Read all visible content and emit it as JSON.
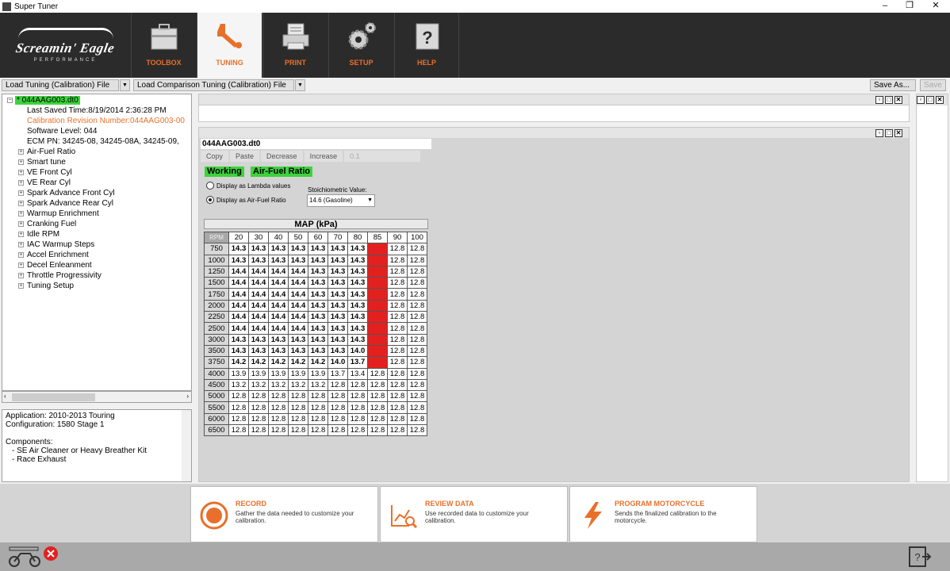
{
  "window": {
    "title": "Super Tuner",
    "min": "–",
    "max": "❐",
    "close": "✕"
  },
  "brand": {
    "logo_text": "Screamin' Eagle",
    "logo_sub": "PERFORMANCE"
  },
  "nav": {
    "tabs": [
      {
        "label": "TOOLBOX",
        "icon": "toolbox-icon"
      },
      {
        "label": "TUNING",
        "icon": "wrench-icon",
        "active": true
      },
      {
        "label": "PRINT",
        "icon": "printer-icon"
      },
      {
        "label": "SETUP",
        "icon": "gears-icon"
      },
      {
        "label": "HELP",
        "icon": "help-icon"
      }
    ]
  },
  "toolbar": {
    "load_tuning": "Load Tuning (Calibration) File",
    "load_comparison": "Load Comparison Tuning (Calibration) File",
    "save_as": "Save As...",
    "save": "Save"
  },
  "tree": {
    "root": "* 044AAG003.dt0",
    "meta": [
      "Last Saved Time:8/19/2014 2:36:28 PM",
      "Calibration Revision Number:044AAG003-00",
      "Software Level: 044",
      "ECM PN: 34245-08, 34245-08A, 34245-09,"
    ],
    "items": [
      "Air-Fuel Ratio",
      "Smart tune",
      "VE Front Cyl",
      "VE Rear Cyl",
      "Spark Advance Front Cyl",
      "Spark Advance Rear Cyl",
      "Warmup Enrichment",
      "Cranking Fuel",
      "Idle RPM",
      "IAC Warmup Steps",
      "Accel Enrichment",
      "Decel Enleanment",
      "Throttle Progressivity",
      "Tuning Setup"
    ]
  },
  "info": {
    "application": "Application: 2010-2013 Touring",
    "configuration": "Configuration: 1580 Stage 1",
    "components_label": "Components:",
    "components": [
      "- SE Air Cleaner or Heavy Breather Kit",
      "- Race Exhaust"
    ]
  },
  "editor": {
    "doc_name": "044AAG003.dt0",
    "copy": "Copy",
    "paste": "Paste",
    "decrease": "Decrease",
    "increase": "Increase",
    "step": "0.1",
    "badge_working": "Working",
    "badge_table": "Air-Fuel Ratio",
    "radio_lambda": "Display as Lambda values",
    "radio_afr": "Display as Air-Fuel Ratio",
    "stoich_label": "Stoichiometric Value:",
    "stoich_value": "14.6 (Gasoline)"
  },
  "table": {
    "title": "MAP (kPa)",
    "corner": "RPM",
    "columns": [
      "20",
      "30",
      "40",
      "50",
      "60",
      "70",
      "80",
      "85",
      "90",
      "100"
    ],
    "rows": [
      {
        "rpm": "750",
        "values": [
          "14.3",
          "14.3",
          "14.3",
          "14.3",
          "14.3",
          "14.3",
          "14.3",
          "14.1",
          "12.8",
          "12.8"
        ]
      },
      {
        "rpm": "1000",
        "values": [
          "14.3",
          "14.3",
          "14.3",
          "14.3",
          "14.3",
          "14.3",
          "14.3",
          "14.1",
          "12.8",
          "12.8"
        ]
      },
      {
        "rpm": "1250",
        "values": [
          "14.4",
          "14.4",
          "14.4",
          "14.4",
          "14.3",
          "14.3",
          "14.3",
          "14.1",
          "12.8",
          "12.8"
        ]
      },
      {
        "rpm": "1500",
        "values": [
          "14.4",
          "14.4",
          "14.4",
          "14.4",
          "14.3",
          "14.3",
          "14.3",
          "14.1",
          "12.8",
          "12.8"
        ]
      },
      {
        "rpm": "1750",
        "values": [
          "14.4",
          "14.4",
          "14.4",
          "14.4",
          "14.3",
          "14.3",
          "14.3",
          "14.1",
          "12.8",
          "12.8"
        ]
      },
      {
        "rpm": "2000",
        "values": [
          "14.4",
          "14.4",
          "14.4",
          "14.4",
          "14.3",
          "14.3",
          "14.3",
          "14.1",
          "12.8",
          "12.8"
        ]
      },
      {
        "rpm": "2250",
        "values": [
          "14.4",
          "14.4",
          "14.4",
          "14.4",
          "14.3",
          "14.3",
          "14.3",
          "14.1",
          "12.8",
          "12.8"
        ]
      },
      {
        "rpm": "2500",
        "values": [
          "14.4",
          "14.4",
          "14.4",
          "14.4",
          "14.3",
          "14.3",
          "14.3",
          "13.8",
          "12.8",
          "12.8"
        ]
      },
      {
        "rpm": "3000",
        "values": [
          "14.3",
          "14.3",
          "14.3",
          "14.3",
          "14.3",
          "14.3",
          "14.3",
          "13.8",
          "12.8",
          "12.8"
        ]
      },
      {
        "rpm": "3500",
        "values": [
          "14.3",
          "14.3",
          "14.3",
          "14.3",
          "14.3",
          "14.3",
          "14.0",
          "13.5",
          "12.8",
          "12.8"
        ]
      },
      {
        "rpm": "3750",
        "values": [
          "14.2",
          "14.2",
          "14.2",
          "14.2",
          "14.2",
          "14.0",
          "13.7",
          "13.0",
          "12.8",
          "12.8"
        ]
      },
      {
        "rpm": "4000",
        "values": [
          "13.9",
          "13.9",
          "13.9",
          "13.9",
          "13.9",
          "13.7",
          "13.4",
          "12.8",
          "12.8",
          "12.8"
        ]
      },
      {
        "rpm": "4500",
        "values": [
          "13.2",
          "13.2",
          "13.2",
          "13.2",
          "13.2",
          "12.8",
          "12.8",
          "12.8",
          "12.8",
          "12.8"
        ]
      },
      {
        "rpm": "5000",
        "values": [
          "12.8",
          "12.8",
          "12.8",
          "12.8",
          "12.8",
          "12.8",
          "12.8",
          "12.8",
          "12.8",
          "12.8"
        ]
      },
      {
        "rpm": "5500",
        "values": [
          "12.8",
          "12.8",
          "12.8",
          "12.8",
          "12.8",
          "12.8",
          "12.8",
          "12.8",
          "12.8",
          "12.8"
        ]
      },
      {
        "rpm": "6000",
        "values": [
          "12.8",
          "12.8",
          "12.8",
          "12.8",
          "12.8",
          "12.8",
          "12.8",
          "12.8",
          "12.8",
          "12.8"
        ]
      },
      {
        "rpm": "6500",
        "values": [
          "12.8",
          "12.8",
          "12.8",
          "12.8",
          "12.8",
          "12.8",
          "12.8",
          "12.8",
          "12.8",
          "12.8"
        ]
      }
    ],
    "bold_rows": 11,
    "bold_cols": 7,
    "highlight_col": 7,
    "highlight_rows": 11,
    "highlight_color": "#e32020"
  },
  "actions": [
    {
      "title": "RECORD",
      "desc": "Gather the data needed to customize your calibration.",
      "icon": "record-icon"
    },
    {
      "title": "REVIEW DATA",
      "desc": "Use recorded data to customize your calibration.",
      "icon": "review-data-icon"
    },
    {
      "title": "PROGRAM MOTORCYCLE",
      "desc": "Sends the finalized calibration to the motorcycle.",
      "icon": "lightning-icon"
    }
  ],
  "colors": {
    "accent": "#e8702a",
    "header_bg": "#2b2b2b",
    "working_green": "#3cd33c"
  }
}
